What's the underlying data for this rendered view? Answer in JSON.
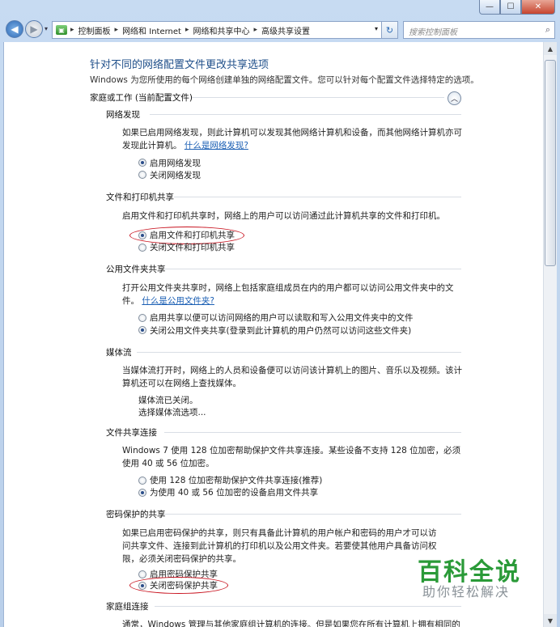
{
  "window": {
    "buttons": {
      "minimize": "—",
      "maximize": "☐",
      "close": "✕"
    }
  },
  "nav": {
    "back_icon": "◀",
    "forward_icon": "▶",
    "address": [
      "控制面板",
      "网络和 Internet",
      "网络和共享中心",
      "高级共享设置"
    ],
    "search_placeholder": "搜索控制面板"
  },
  "page": {
    "title": "针对不同的网络配置文件更改共享选项",
    "subtitle": "Windows 为您所使用的每个网络创建单独的网络配置文件。您可以针对每个配置文件选择特定的选项。",
    "profile": "家庭或工作 (当前配置文件)"
  },
  "sections": {
    "discovery": {
      "title": "网络发现",
      "desc": "如果已启用网络发现，则此计算机可以发现其他网络计算机和设备，而其他网络计算机亦可发现此计算机。",
      "link": "什么是网络发现?",
      "options": [
        "启用网络发现",
        "关闭网络发现"
      ]
    },
    "file_printer": {
      "title": "文件和打印机共享",
      "desc": "启用文件和打印机共享时，网络上的用户可以访问通过此计算机共享的文件和打印机。",
      "options": [
        "启用文件和打印机共享",
        "关闭文件和打印机共享"
      ]
    },
    "public_folder": {
      "title": "公用文件夹共享",
      "desc": "打开公用文件夹共享时，网络上包括家庭组成员在内的用户都可以访问公用文件夹中的文件。",
      "link": "什么是公用文件夹?",
      "options": [
        "启用共享以便可以访问网络的用户可以读取和写入公用文件夹中的文件",
        "关闭公用文件夹共享(登录到此计算机的用户仍然可以访问这些文件夹)"
      ]
    },
    "media": {
      "title": "媒体流",
      "desc": "当媒体流打开时，网络上的人员和设备便可以访问该计算机上的图片、音乐以及视频。该计算机还可以在网络上查找媒体。",
      "status": "媒体流已关闭。",
      "link": "选择媒体流选项..."
    },
    "file_sharing": {
      "title": "文件共享连接",
      "desc": "Windows 7 使用 128 位加密帮助保护文件共享连接。某些设备不支持 128 位加密，必须使用 40 或 56 位加密。",
      "options": [
        "使用 128 位加密帮助保护文件共享连接(推荐)",
        "为使用 40 或 56 位加密的设备启用文件共享"
      ]
    },
    "password": {
      "title": "密码保护的共享",
      "desc": "如果已启用密码保护的共享，则只有具备此计算机的用户帐户和密码的用户才可以访问共享文件、连接到此计算机的打印机以及公用文件夹。若要使其他用户具备访问权限，必须关闭密码保护的共享。",
      "options": [
        "启用密码保护共享",
        "关闭密码保护共享"
      ]
    },
    "homegroup": {
      "title": "家庭组连接",
      "desc": "通常，Windows 管理与其他家庭组计算机的连接。但是如果您在所有计算机上拥有相同的用户帐户"
    }
  },
  "watermark": {
    "line1": "百科全说",
    "line2": "助你轻松解决"
  }
}
